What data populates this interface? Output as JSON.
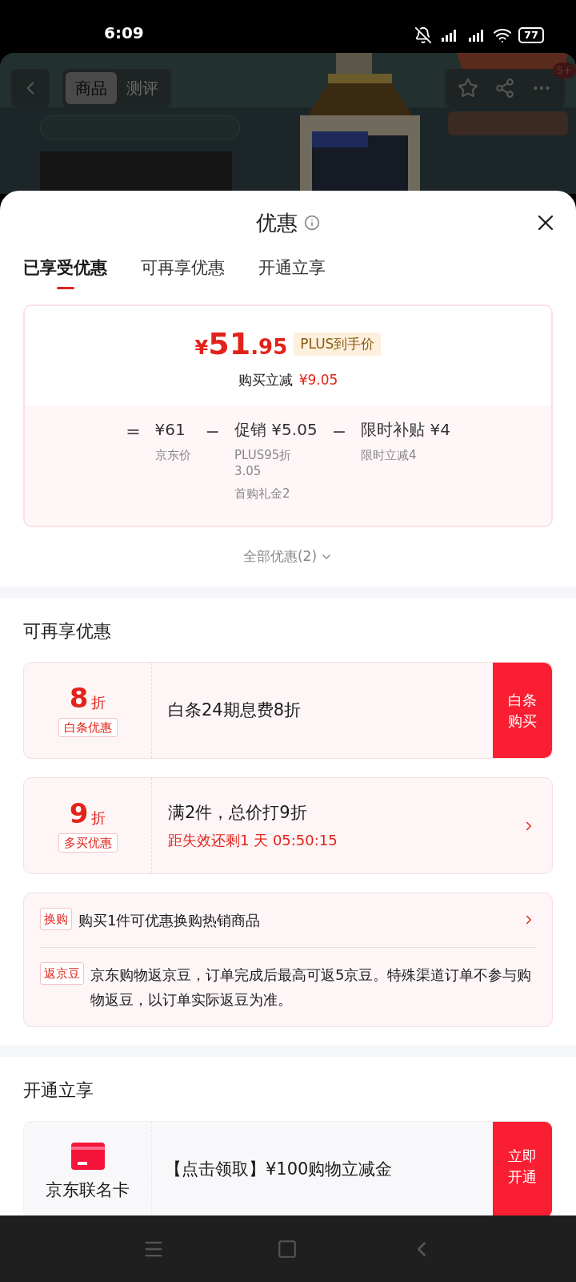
{
  "status_bar": {
    "time": "6:09",
    "battery": "77"
  },
  "background_page": {
    "tabs": [
      {
        "label": "商品",
        "selected": true
      },
      {
        "label": "测评",
        "selected": false
      }
    ],
    "badge": "5+"
  },
  "sheet": {
    "title": "优惠",
    "tabs": [
      {
        "label": "已享受优惠",
        "selected": true
      },
      {
        "label": "可再享优惠",
        "selected": false
      },
      {
        "label": "开通立享",
        "selected": false
      }
    ],
    "summary": {
      "currency": "¥",
      "price_int": "51",
      "price_dec": ".95",
      "price_tag": "PLUS到手价",
      "reduction_label": "购买立减",
      "reduction_value": "¥9.05",
      "breakdown": [
        {
          "kind": "operator",
          "text": "="
        },
        {
          "kind": "item",
          "amount": "¥61",
          "notes": [
            "京东价"
          ]
        },
        {
          "kind": "operator",
          "text": "−"
        },
        {
          "kind": "item",
          "amount": "促销 ¥5.05",
          "notes": [
            "PLUS95折 3.05",
            "首购礼金2"
          ]
        },
        {
          "kind": "operator",
          "text": "−"
        },
        {
          "kind": "item",
          "amount": "限时补贴 ¥4",
          "notes": [
            "限时立减4"
          ]
        }
      ],
      "more_link": "全部优惠(2)"
    },
    "more_offers": {
      "heading": "可再享优惠",
      "coupons": [
        {
          "big": "8",
          "unit": "折",
          "tag": "白条优惠",
          "title": "白条24期息费8折",
          "action": {
            "kind": "button",
            "label": "白条购买"
          }
        },
        {
          "big": "9",
          "unit": "折",
          "tag": "多买优惠",
          "title": "满2件，总价打9折",
          "countdown": "距失效还剩1 天 05:50:15",
          "action": {
            "kind": "chevron"
          }
        }
      ],
      "notes": [
        {
          "tag": "换购",
          "text": "购买1件可优惠换购热销商品",
          "chevron": true
        },
        {
          "tag": "返京豆",
          "text": "京东购物返京豆，订单完成后最高可返5京豆。特殊渠道订单不参与购物返豆，以订单实际返豆为准。",
          "chevron": false
        }
      ]
    },
    "open_now": {
      "heading": "开通立享",
      "cards": [
        {
          "name": "京东联名卡",
          "title": "【点击领取】¥100购物立减金",
          "action": "立即开通"
        }
      ]
    }
  }
}
